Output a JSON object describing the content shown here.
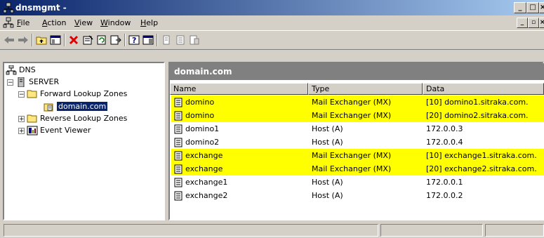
{
  "window": {
    "title": "dnsmgmt -"
  },
  "menu": {
    "items": [
      {
        "label": "File",
        "accel": "F",
        "rest": "ile"
      },
      {
        "label": "Action",
        "accel": "A",
        "rest": "ction"
      },
      {
        "label": "View",
        "accel": "V",
        "rest": "iew"
      },
      {
        "label": "Window",
        "accel": "W",
        "rest": "indow"
      },
      {
        "label": "Help",
        "accel": "H",
        "rest": "elp"
      }
    ]
  },
  "toolbar": {
    "icons": [
      "back-icon",
      "forward-icon",
      "up-folder-icon",
      "show-tree-icon",
      "delete-icon",
      "properties-icon",
      "refresh-icon",
      "export-icon",
      "help-icon",
      "console-icon",
      "new-host-icon",
      "new-record-icon",
      "new-domain-icon"
    ]
  },
  "tree": {
    "nodes": [
      {
        "label": "DNS"
      },
      {
        "label": "SERVER"
      },
      {
        "label": "Forward Lookup Zones"
      },
      {
        "label": "domain.com"
      },
      {
        "label": "Reverse Lookup Zones"
      },
      {
        "label": "Event Viewer"
      }
    ]
  },
  "pane": {
    "title": "domain.com",
    "columns": {
      "name": "Name",
      "type": "Type",
      "data": "Data"
    },
    "rows": [
      {
        "name": "domino",
        "type": "Mail Exchanger (MX)",
        "data": "[10]  domino1.sitraka.com.",
        "highlight": true
      },
      {
        "name": "domino",
        "type": "Mail Exchanger (MX)",
        "data": "[20]  domino2.sitraka.com.",
        "highlight": true
      },
      {
        "name": "domino1",
        "type": "Host (A)",
        "data": "172.0.0.3",
        "highlight": false
      },
      {
        "name": "domino2",
        "type": "Host (A)",
        "data": "172.0.0.4",
        "highlight": false
      },
      {
        "name": "exchange",
        "type": "Mail Exchanger (MX)",
        "data": "[10]  exchange1.sitraka.com.",
        "highlight": true
      },
      {
        "name": "exchange",
        "type": "Mail Exchanger (MX)",
        "data": "[20]  exchange2.sitraka.com.",
        "highlight": true
      },
      {
        "name": "exchange1",
        "type": "Host (A)",
        "data": "172.0.0.1",
        "highlight": false
      },
      {
        "name": "exchange2",
        "type": "Host (A)",
        "data": "172.0.0.2",
        "highlight": false
      }
    ]
  },
  "colors": {
    "highlight": "#ffff00",
    "titlebar_start": "#0a246a",
    "titlebar_end": "#a6caf0",
    "selection": "#0a246a"
  }
}
